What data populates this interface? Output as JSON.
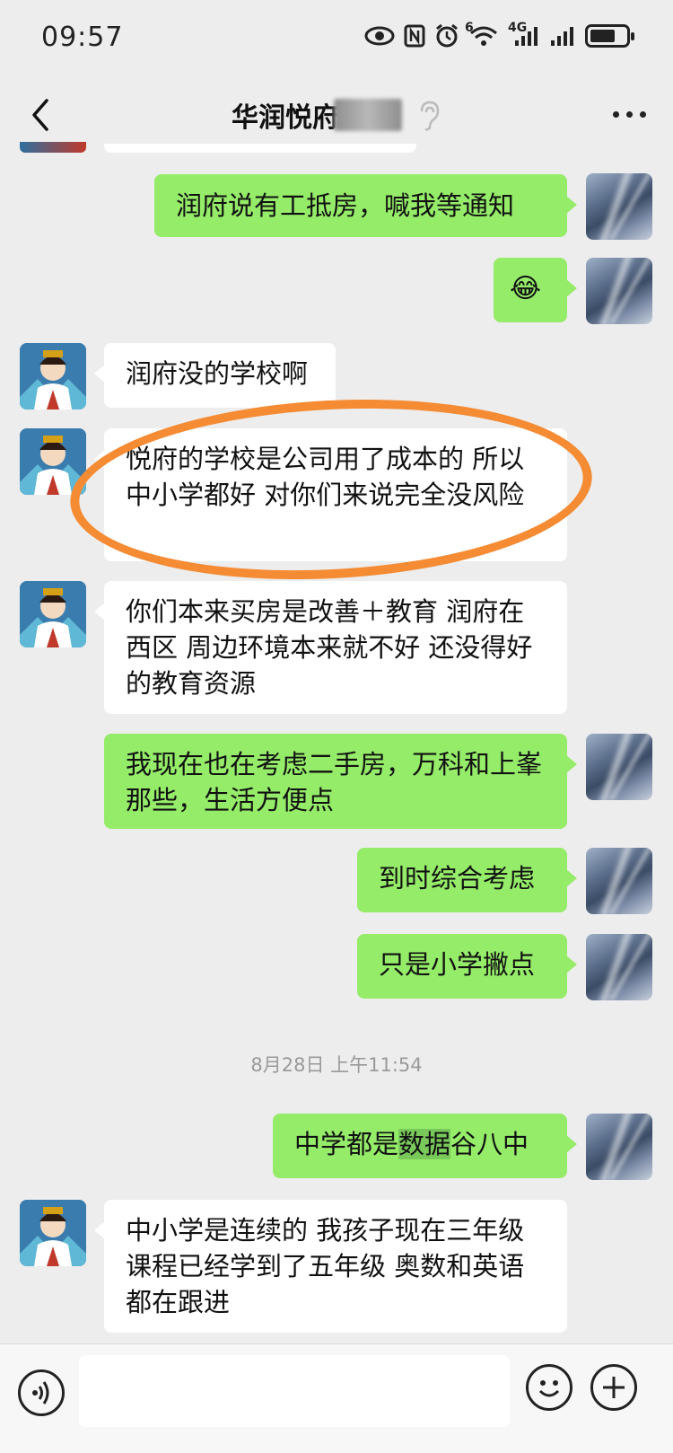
{
  "status_bar": {
    "time": "09:57",
    "icons": [
      "eye-icon",
      "nfc-icon",
      "alarm-icon",
      "wifi-icon",
      "signal-4g-icon",
      "signal-icon",
      "battery-icon"
    ],
    "network_label": "4G",
    "wifi_label": "6",
    "battery_level": 0.7
  },
  "header": {
    "title": "华润悦府",
    "title_obscured": true
  },
  "messages": [
    {
      "side": "in",
      "text": "",
      "partial": true
    },
    {
      "side": "out",
      "text": "润府说有工抵房，喊我等通知"
    },
    {
      "side": "out",
      "text": "😂",
      "emoji": true
    },
    {
      "side": "in",
      "text": "润府没的学校啊"
    },
    {
      "side": "in",
      "text": "悦府的学校是公司用了成本的 所以中小学都好 对你们来说完全没风险",
      "highlighted": true
    },
    {
      "side": "in",
      "text": "你们本来买房是改善＋教育 润府在西区 周边环境本来就不好 还没得好的教育资源"
    },
    {
      "side": "out",
      "text": "我现在也在考虑二手房，万科和上峯那些，生活方便点"
    },
    {
      "side": "out",
      "text": "到时综合考虑"
    },
    {
      "side": "out",
      "text": "只是小学撇点"
    },
    {
      "side": "out",
      "text_before": "中学都是",
      "text_highlight": "数据",
      "text_after": "谷八中"
    },
    {
      "side": "in",
      "text": "中小学是连续的 我孩子现在三年级 课程已经学到了五年级 奥数和英语都在跟进"
    }
  ],
  "timestamp": "8月28日 上午11:54",
  "colors": {
    "outgoing_bubble": "#95ec69",
    "incoming_bubble": "#ffffff",
    "background": "#ededed",
    "annotation": "#f58b33"
  }
}
